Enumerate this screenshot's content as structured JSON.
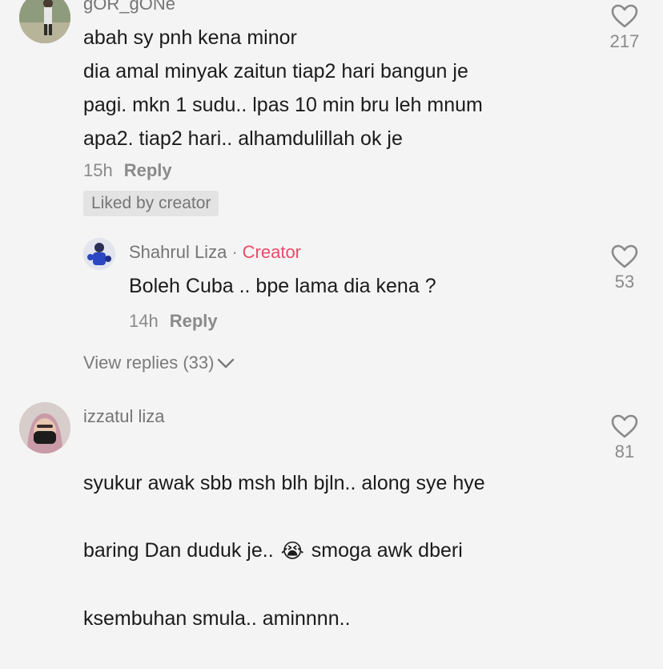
{
  "comments": [
    {
      "username": "gOR_gONe",
      "text": "abah sy pnh kena minor\ndia amal minyak zaitun tiap2 hari bangun je\npagi. mkn 1 sudu.. lpas 10 min bru leh mnum\napa2. tiap2 hari.. alhamdulillah ok je",
      "time": "15h",
      "reply_label": "Reply",
      "liked_badge": "Liked by creator",
      "like_count": "217",
      "icons": {
        "like": "heart-outline-icon"
      },
      "replies": [
        {
          "username": "Shahrul Liza",
          "separator": "·",
          "tag": "Creator",
          "tag_color": "#ea4a6a",
          "text": "Boleh Cuba .. bpe lama dia kena ?",
          "time": "14h",
          "reply_label": "Reply",
          "like_count": "53"
        }
      ],
      "view_replies": "View replies (33)"
    },
    {
      "username": "izzatul liza",
      "text_line1": "syukur awak sbb msh blh bjln.. along sye hye",
      "text_line2_before": "baring Dan duduk je..",
      "emoji": "😭",
      "text_line2_after": "smoga awk dberi",
      "text_line3": "ksembuhan smula.. aminnnn..",
      "like_count": "81"
    }
  ]
}
